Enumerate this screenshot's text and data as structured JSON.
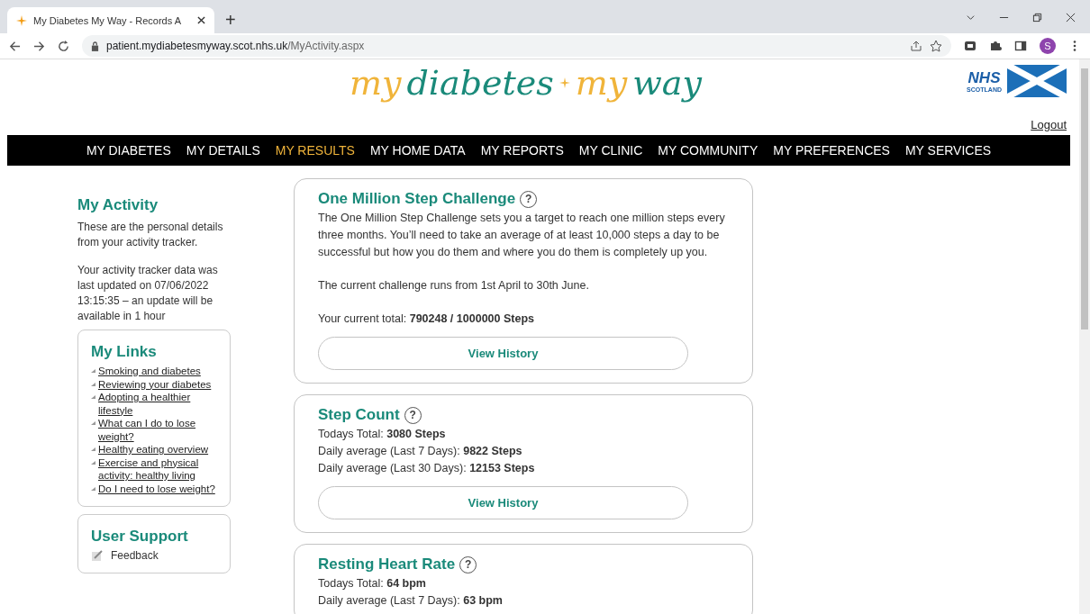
{
  "browser": {
    "tab_title": "My Diabetes My Way - Records A",
    "new_tab": "+",
    "url_host": "patient.mydiabetesmyway.scot.nhs.uk",
    "url_path": "/MyActivity.aspx",
    "profile": "S"
  },
  "header": {
    "logo_words": [
      "my",
      "diabetes",
      "my",
      "way"
    ],
    "nhs_text": "NHS",
    "nhs_sub": "SCOTLAND",
    "logout": "Logout"
  },
  "nav": [
    {
      "label": "MY DIABETES",
      "selected": false
    },
    {
      "label": "MY DETAILS",
      "selected": false
    },
    {
      "label": "MY RESULTS",
      "selected": true
    },
    {
      "label": "MY HOME DATA",
      "selected": false
    },
    {
      "label": "MY REPORTS",
      "selected": false
    },
    {
      "label": "MY CLINIC",
      "selected": false
    },
    {
      "label": "MY COMMUNITY",
      "selected": false
    },
    {
      "label": "MY PREFERENCES",
      "selected": false
    },
    {
      "label": "MY SERVICES",
      "selected": false
    }
  ],
  "sidebar": {
    "title": "My Activity",
    "paragraphs": [
      "These are the personal details from your activity tracker.",
      "Your activity tracker data was last updated on 07/06/2022 13:15:35 – an update will be available in 1 hour"
    ],
    "links_title": "My Links",
    "links": [
      "Smoking and diabetes",
      "Reviewing your diabetes",
      "Adopting a healthier lifestyle",
      "What can I do to lose weight?",
      "Healthy eating overview",
      "Exercise and physical activity: healthy living",
      "Do I need to lose weight?"
    ],
    "support_title": "User Support",
    "support_items": [
      "Feedback"
    ]
  },
  "cards": [
    {
      "kind": "text",
      "title": "One Million Step Challenge",
      "help": "?",
      "lines": [
        "The One Million Step Challenge sets you a target to reach one million steps every three months. You’ll need to take an average of at least 10,000 steps a day to be successful but how you do them and where you do them is completely up you.",
        "The current challenge runs from 1st April to 30th June.",
        "Your current total: **790248 / 1000000 Steps**"
      ],
      "button": "View History"
    },
    {
      "kind": "stats",
      "title": "Step Count",
      "help": "?",
      "lines": [
        "Todays Total: **3080 Steps**",
        "Daily average (Last 7 Days): **9822 Steps**",
        "Daily average (Last 30 Days): **12153 Steps**"
      ],
      "button": "View History"
    },
    {
      "kind": "stats",
      "title": "Resting Heart Rate",
      "help": "?",
      "lines": [
        "Todays Total: **64 bpm**",
        "Daily average (Last 7 Days): **63 bpm**"
      ]
    }
  ]
}
